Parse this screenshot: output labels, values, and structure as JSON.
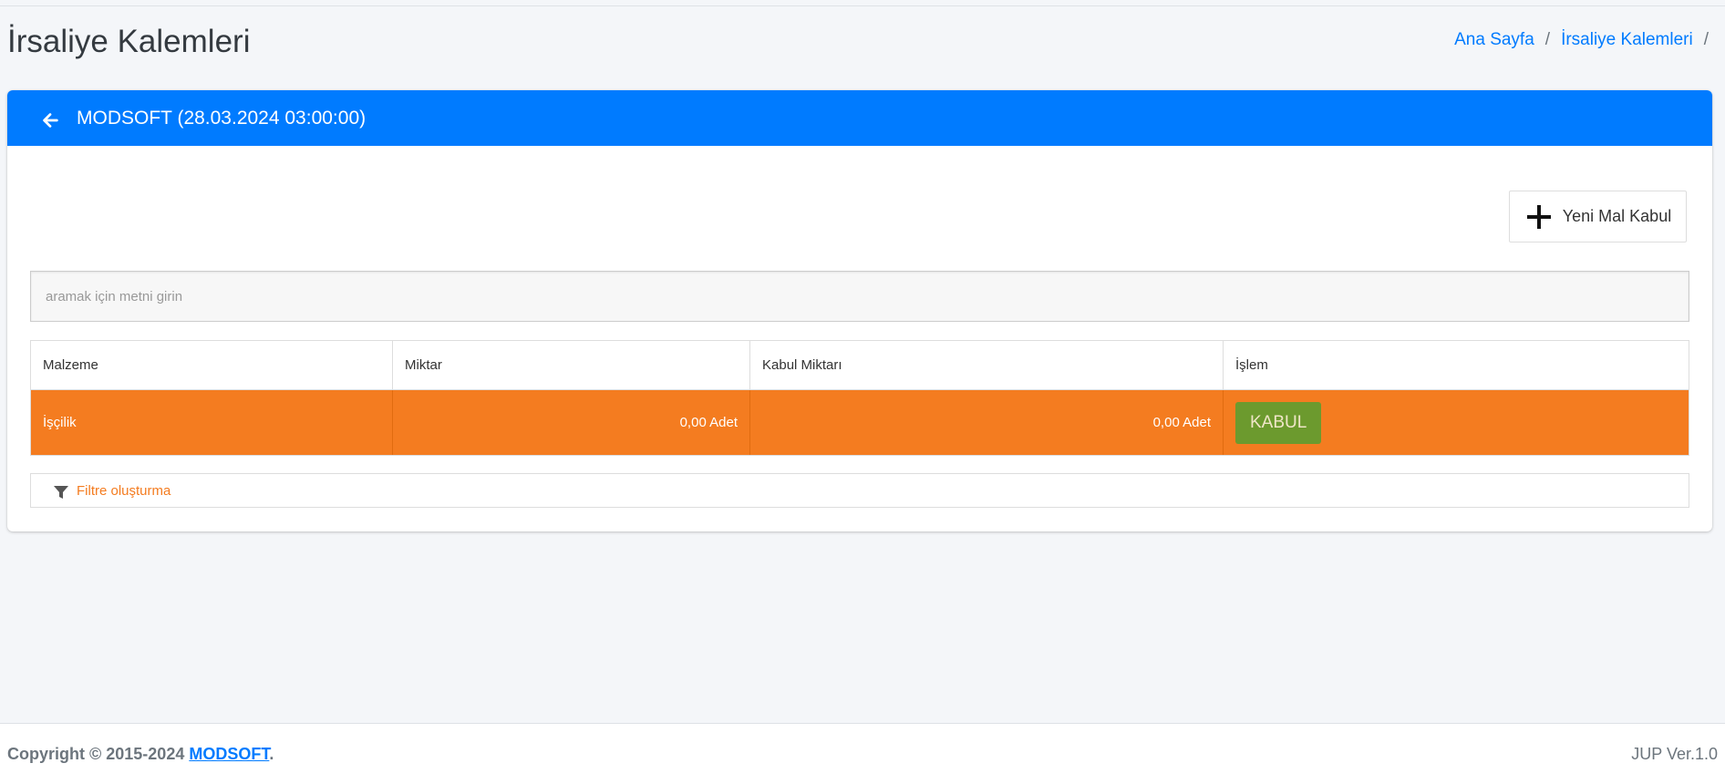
{
  "page": {
    "title": "İrsaliye Kalemleri"
  },
  "breadcrumb": {
    "home": "Ana Sayfa",
    "current": "İrsaliye Kalemleri",
    "separator": "/"
  },
  "card": {
    "title": "MODSOFT (28.03.2024 03:00:00)",
    "back_icon": "arrow-left-icon",
    "header_color": "#007bff"
  },
  "toolbar": {
    "new_button_label": "Yeni Mal Kabul",
    "new_button_icon": "plus-icon"
  },
  "search": {
    "placeholder": "aramak için metni girin",
    "value": ""
  },
  "table": {
    "columns": [
      "Malzeme",
      "Miktar",
      "Kabul Miktarı",
      "İşlem"
    ],
    "rows": [
      {
        "malzeme": "İşçilik",
        "miktar": "0,00 Adet",
        "kabul_miktari": "0,00 Adet",
        "action_label": "KABUL"
      }
    ],
    "row_color": "#f47c20",
    "action_color": "#6c9a2e"
  },
  "filter": {
    "label": "Filtre oluşturma",
    "icon": "filter-icon"
  },
  "footer": {
    "copyright": "Copyright © 2015-2024",
    "brand": "MODSOFT",
    "brand_suffix": ".",
    "version": "JUP Ver.1.0"
  }
}
